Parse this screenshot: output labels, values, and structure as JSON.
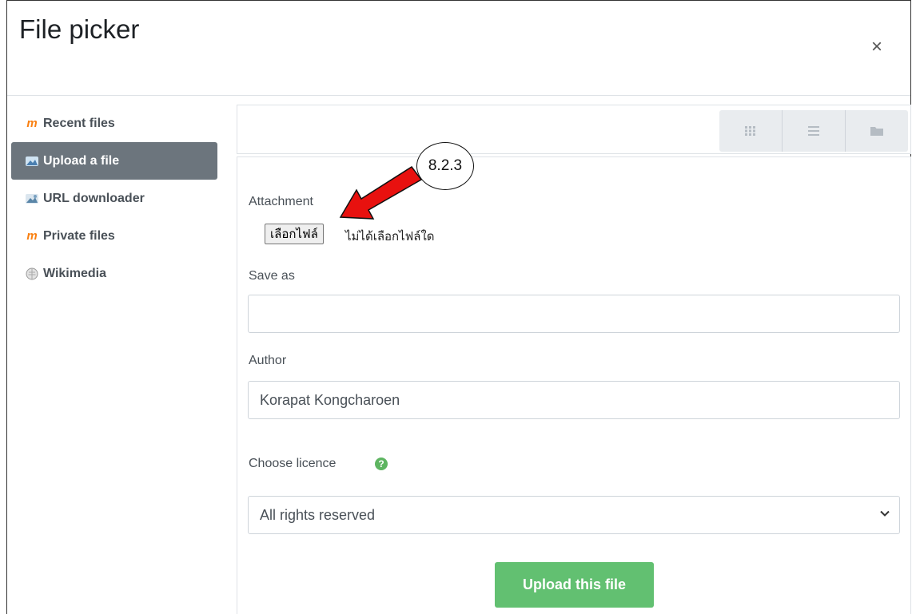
{
  "dialog": {
    "title": "File picker",
    "close_glyph": "×"
  },
  "sidebar": {
    "items": [
      {
        "label": "Recent files",
        "icon": "moodle-icon"
      },
      {
        "label": "Upload a file",
        "icon": "upload-icon",
        "active": true
      },
      {
        "label": "URL downloader",
        "icon": "url-icon"
      },
      {
        "label": "Private files",
        "icon": "moodle-icon"
      },
      {
        "label": "Wikimedia",
        "icon": "wikimedia-icon"
      }
    ]
  },
  "toolbar": {
    "view_icons": [
      "grid-view-icon",
      "list-view-icon",
      "folder-view-icon"
    ]
  },
  "form": {
    "attachment_label": "Attachment",
    "choose_file_button": "เลือกไฟล์",
    "no_file_text": "ไม่ได้เลือกไฟล์ใด",
    "save_as_label": "Save as",
    "save_as_value": "",
    "author_label": "Author",
    "author_value": "Korapat Kongcharoen",
    "licence_label": "Choose licence",
    "licence_help_glyph": "?",
    "licence_value": "All rights reserved",
    "upload_button": "Upload this file"
  },
  "annotation": {
    "callout": "8.2.3",
    "arrow_color": "#e8110f"
  },
  "colors": {
    "active_bg": "#6c757d",
    "upload_bg": "#62c071",
    "help_bg": "#5eb561",
    "moodle_orange": "#f98012"
  }
}
